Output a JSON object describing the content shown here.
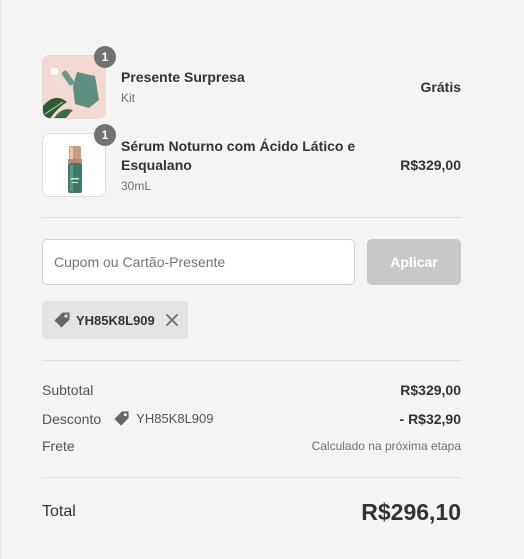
{
  "items": [
    {
      "name": "Presente Surpresa",
      "variant": "Kit",
      "quantity": "1",
      "price": "Grátis"
    },
    {
      "name": "Sérum Noturno com Ácido Lático e Esqualano",
      "variant": "30mL",
      "quantity": "1",
      "price": "R$329,00"
    }
  ],
  "coupon": {
    "placeholder": "Cupom ou Cartão-Presente",
    "apply_label": "Aplicar",
    "applied_code": "YH85K8L909"
  },
  "summary": {
    "subtotal_label": "Subtotal",
    "subtotal_value": "R$329,00",
    "discount_label": "Desconto",
    "discount_code": "YH85K8L909",
    "discount_value": "- R$32,90",
    "shipping_label": "Frete",
    "shipping_value": "Calculado na próxima etapa",
    "total_label": "Total",
    "total_value": "R$296,10"
  },
  "colors": {
    "background": "#f4f4f4",
    "badge": "#727272",
    "button_disabled": "#c8c8c8",
    "chip": "#e4e4e4",
    "product_gift_bg": "#f3d9d2",
    "product_green": "#5f8f80"
  },
  "icons": [
    "tag-icon",
    "close-icon",
    "gift-product-image",
    "serum-product-image"
  ]
}
